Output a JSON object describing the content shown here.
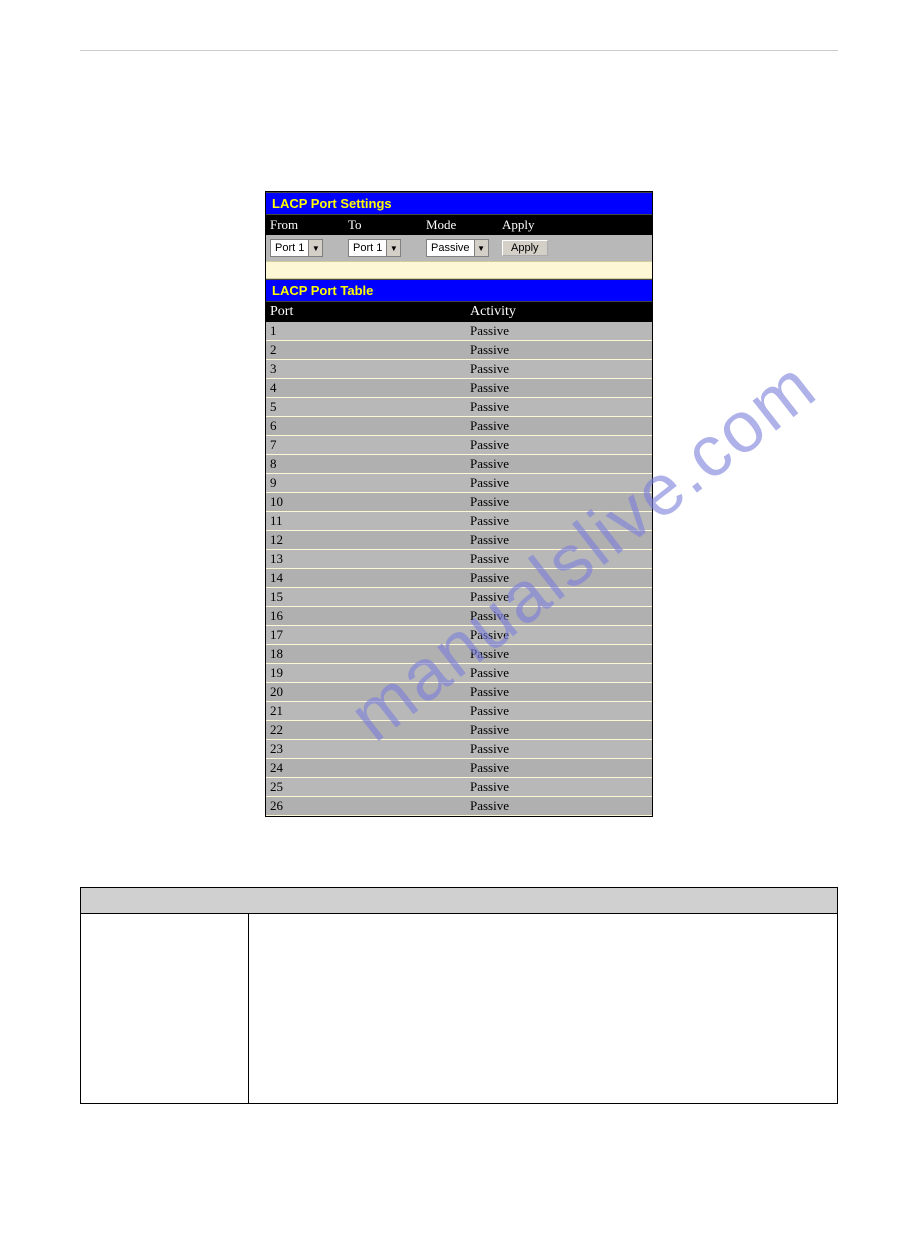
{
  "watermark": "manualslive.com",
  "settings": {
    "title": "LACP Port Settings",
    "columns": {
      "from": "From",
      "to": "To",
      "mode": "Mode",
      "apply": "Apply"
    },
    "values": {
      "from": "Port 1",
      "to": "Port 1",
      "mode": "Passive",
      "apply_label": "Apply"
    }
  },
  "table": {
    "title": "LACP Port Table",
    "headers": {
      "port": "Port",
      "activity": "Activity"
    },
    "rows": [
      {
        "port": "1",
        "activity": "Passive"
      },
      {
        "port": "2",
        "activity": "Passive"
      },
      {
        "port": "3",
        "activity": "Passive"
      },
      {
        "port": "4",
        "activity": "Passive"
      },
      {
        "port": "5",
        "activity": "Passive"
      },
      {
        "port": "6",
        "activity": "Passive"
      },
      {
        "port": "7",
        "activity": "Passive"
      },
      {
        "port": "8",
        "activity": "Passive"
      },
      {
        "port": "9",
        "activity": "Passive"
      },
      {
        "port": "10",
        "activity": "Passive"
      },
      {
        "port": "11",
        "activity": "Passive"
      },
      {
        "port": "12",
        "activity": "Passive"
      },
      {
        "port": "13",
        "activity": "Passive"
      },
      {
        "port": "14",
        "activity": "Passive"
      },
      {
        "port": "15",
        "activity": "Passive"
      },
      {
        "port": "16",
        "activity": "Passive"
      },
      {
        "port": "17",
        "activity": "Passive"
      },
      {
        "port": "18",
        "activity": "Passive"
      },
      {
        "port": "19",
        "activity": "Passive"
      },
      {
        "port": "20",
        "activity": "Passive"
      },
      {
        "port": "21",
        "activity": "Passive"
      },
      {
        "port": "22",
        "activity": "Passive"
      },
      {
        "port": "23",
        "activity": "Passive"
      },
      {
        "port": "24",
        "activity": "Passive"
      },
      {
        "port": "25",
        "activity": "Passive"
      },
      {
        "port": "26",
        "activity": "Passive"
      }
    ]
  }
}
